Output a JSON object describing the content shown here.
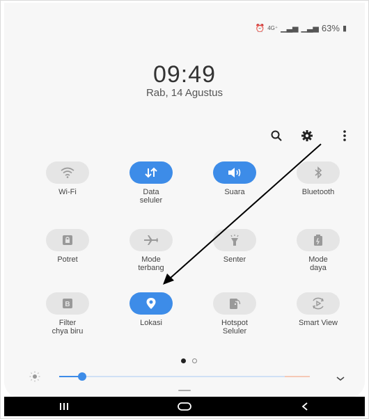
{
  "status_bar": {
    "battery": "63%",
    "icons": [
      "alarm-icon",
      "4g-icon",
      "signal-icon",
      "signal-icon",
      "battery-icon"
    ]
  },
  "clock": {
    "time": "09:49",
    "date": "Rab, 14 Agustus"
  },
  "top_actions": [
    "search-icon",
    "gear-icon",
    "more-vert-icon"
  ],
  "tiles": [
    {
      "label": "Wi-Fi",
      "icon": "wifi-icon",
      "on": false
    },
    {
      "label": "Data\nseluler",
      "icon": "data-arrows-icon",
      "on": true
    },
    {
      "label": "Suara",
      "icon": "volume-icon",
      "on": true
    },
    {
      "label": "Bluetooth",
      "icon": "bluetooth-icon",
      "on": false
    },
    {
      "label": "Potret",
      "icon": "portrait-lock-icon",
      "on": false
    },
    {
      "label": "Mode\nterbang",
      "icon": "airplane-icon",
      "on": false
    },
    {
      "label": "Senter",
      "icon": "flashlight-icon",
      "on": false
    },
    {
      "label": "Mode\ndaya",
      "icon": "power-mode-icon",
      "on": false
    },
    {
      "label": "Filter\nchya biru",
      "icon": "blue-light-filter-icon",
      "on": false
    },
    {
      "label": "Lokasi",
      "icon": "location-icon",
      "on": true
    },
    {
      "label": "Hotspot\nSeluler",
      "icon": "hotspot-icon",
      "on": false
    },
    {
      "label": "Smart View",
      "icon": "smart-view-icon",
      "on": false
    }
  ],
  "page_indicator": {
    "current": 1,
    "total": 2
  },
  "brightness": {
    "level": 0.1
  },
  "navbar": [
    "recents-icon",
    "home-icon",
    "back-icon"
  ],
  "colors": {
    "accent": "#3d8ce8",
    "tile_off": "#e5e5e5",
    "annotation_arrow": "#000000"
  }
}
